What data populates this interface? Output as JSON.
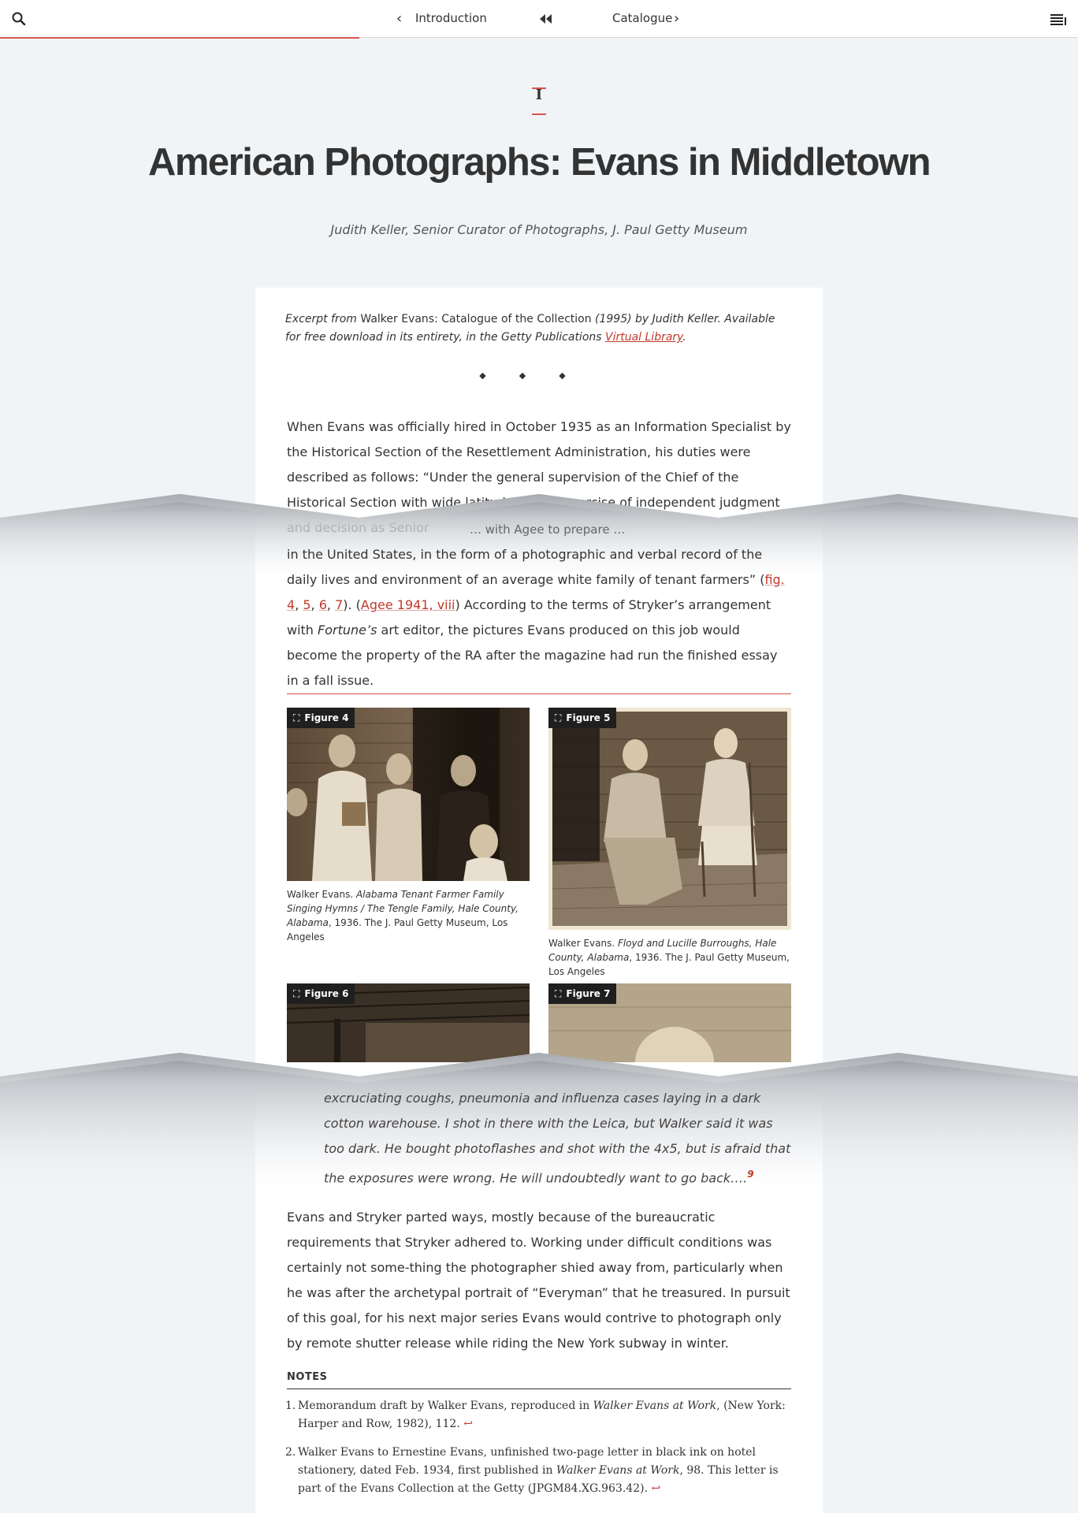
{
  "nav": {
    "prev_label": "Introduction",
    "next_label": "Catalogue",
    "prev_chevron": "‹",
    "next_chevron": "›",
    "home_icon": "double-chevron-left-icon",
    "search_icon": "search-icon",
    "menu_icon": "menu-icon",
    "reading_progress_fraction": 0.333
  },
  "chapter": {
    "number": "I",
    "title": "American Photographs: Evans in Middletown",
    "author": "Judith Keller, Senior Curator of Photographs, J. Paul Getty Museum"
  },
  "excerpt": {
    "lead": "Excerpt from",
    "book": " Walker Evans: Catalogue of the Collection ",
    "mid": "(1995) by Judith Keller. Available for free download in its entirety, in the Getty Publications ",
    "link": "Virtual Library",
    "end": "."
  },
  "separator": "◆◆◆",
  "body": {
    "p1": "When Evans was officially hired in October 1935 as an Information Specialist by the Historical Section of the Resettlement Administration, his duties were described as follows: “Under the general supervision of the Chief of the Historical Section with wide latitude for the exercise of independent judgment and decision as Senior",
    "p1_fragment": "… with Agee to prepare …",
    "p2_a": "in the United States, in the form of a photographic and verbal record of the daily lives and environment of an average white family of tenant farmers” (",
    "p2_fig4": "fig. 4",
    "p2_comma1": ", ",
    "p2_fig5": "5",
    "p2_comma2": ", ",
    "p2_fig6": "6",
    "p2_comma3": ", ",
    "p2_fig7": "7",
    "p2_b": "). (",
    "p2_ref": "Agee 1941, viii",
    "p2_c": ") According to the terms of Stryker’s arrangement with ",
    "p2_fortune": "Fortune’s",
    "p2_d": " art editor, the pictures Evans produced on this job would become the property of the RA after the magazine had run the finished essay in a fall issue.",
    "quote": "excruciating coughs, pneumonia and influenza cases laying in a dark cotton warehouse. I shot in there with the Leica, but Walker said it was too dark. He bought photoflashes and shot with the 4x5, but is afraid that the exposures were wrong. He will undoubtedly want to go back….",
    "quote_note": "9",
    "p3": "Evans and Stryker parted ways, mostly because of the bureaucratic requirements that Stryker adhered to. Working under difficult conditions was certainly not some-thing the photographer shied away from, particularly when he was after the archetypal portrait of “Everyman” that he treasured. In pursuit of this goal, for his next major series Evans would contrive to photograph only by remote shutter release while riding the New York subway in winter."
  },
  "figures": [
    {
      "tag": "Figure 4",
      "caption_a": "Walker Evans. ",
      "caption_title": "Alabama Tenant Farmer Family Singing Hymns / The Tengle Family, Hale County, Alabama",
      "caption_b": ", 1936. The J. Paul Getty Museum, Los Angeles"
    },
    {
      "tag": "Figure 5",
      "caption_a": "Walker Evans. ",
      "caption_title": "Floyd and Lucille Burroughs, Hale County, Alabama",
      "caption_b": ", 1936. The J. Paul Getty Museum, Los Angeles"
    },
    {
      "tag": "Figure 6"
    },
    {
      "tag": "Figure 7"
    }
  ],
  "notes": {
    "heading": "NOTES",
    "items": [
      {
        "num": "1.",
        "a": "Memorandum draft by Walker Evans, reproduced in ",
        "i": "Walker Evans at Work",
        "b": ", (New York: Harper and Row, 1982), 112.",
        "back": " ↩"
      },
      {
        "num": "2.",
        "a": "Walker Evans to Ernestine Evans, unfinished two-page letter in black ink on hotel stationery, dated Feb. 1934, first published in ",
        "i": "Walker Evans at Work",
        "b": ", 98. This letter is part of the Evans Collection at the Getty (JPGM84.XG.963.42).",
        "back": " ↩"
      }
    ]
  },
  "colors": {
    "accent": "#d9534f",
    "link": "#c0392b",
    "page_bg": "#f1f4f7"
  }
}
